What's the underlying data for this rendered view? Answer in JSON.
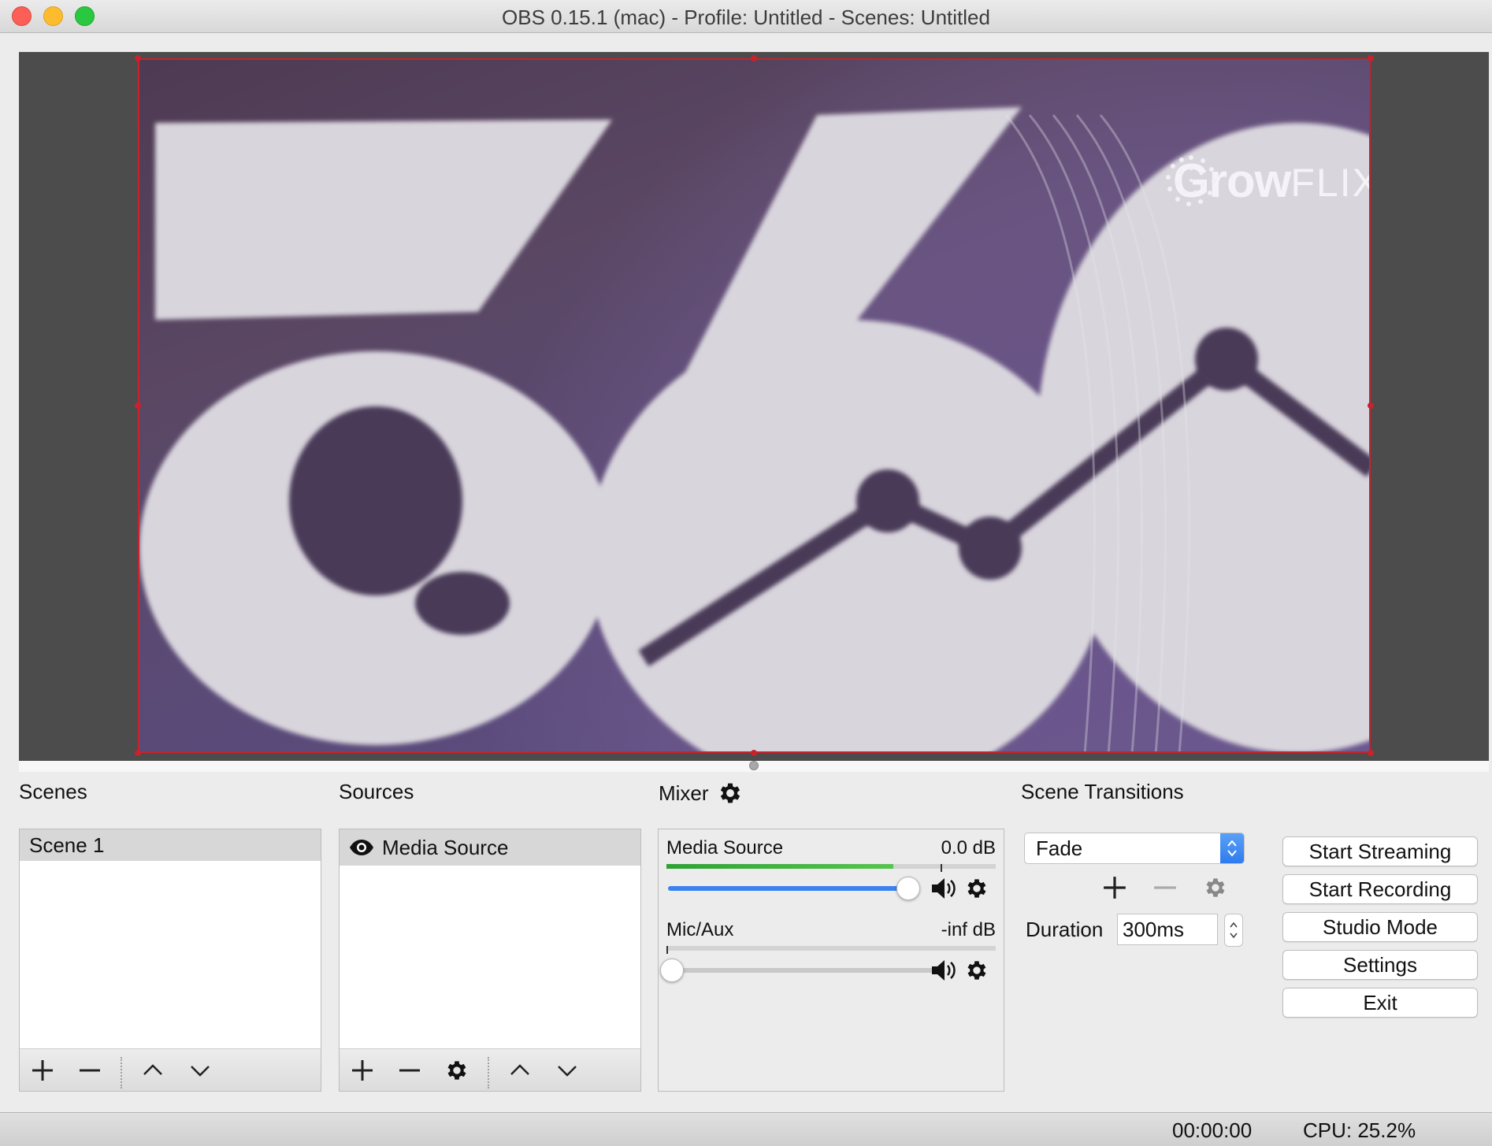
{
  "window": {
    "title": "OBS 0.15.1 (mac) - Profile: Untitled - Scenes: Untitled"
  },
  "preview": {
    "logo_grow": "Grow",
    "logo_flix": "FLIX",
    "big_digits": "360"
  },
  "docks": {
    "scenes_label": "Scenes",
    "sources_label": "Sources",
    "mixer_label": "Mixer",
    "transitions_label": "Scene Transitions"
  },
  "scenes": {
    "items": [
      "Scene 1"
    ]
  },
  "sources": {
    "items": [
      "Media Source"
    ]
  },
  "mixer": {
    "channels": [
      {
        "name": "Media Source",
        "db": "0.0 dB",
        "level": 0.69,
        "volume": 1.0
      },
      {
        "name": "Mic/Aux",
        "db": "-inf dB",
        "level": 0.0,
        "volume": 0.0
      }
    ]
  },
  "transitions": {
    "selected": "Fade",
    "duration_label": "Duration",
    "duration_value": "300ms"
  },
  "controls": {
    "start_streaming": "Start Streaming",
    "start_recording": "Start Recording",
    "studio_mode": "Studio Mode",
    "settings": "Settings",
    "exit": "Exit"
  },
  "status": {
    "time": "00:00:00",
    "cpu": "CPU: 25.2%"
  },
  "colors": {
    "selection_border": "#c8232c",
    "accent_blue": "#3b82f0",
    "meter_green": "#2fa236"
  },
  "icons": [
    "close-icon",
    "minimize-icon",
    "maximize-icon",
    "gear-icon",
    "eye-icon",
    "plus-icon",
    "minus-icon",
    "chevron-up-icon",
    "chevron-down-icon",
    "speaker-icon"
  ]
}
